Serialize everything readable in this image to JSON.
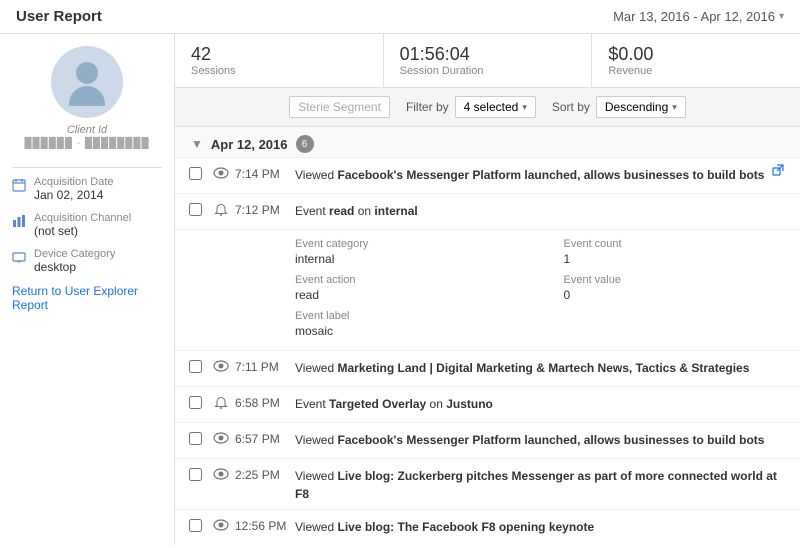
{
  "header": {
    "title": "User Report",
    "date_range": "Mar 13, 2016 - Apr 12, 2016"
  },
  "stats": [
    {
      "value": "42",
      "label": "Sessions"
    },
    {
      "value": "01:56:04",
      "label": "Session Duration"
    },
    {
      "value": "$0.00",
      "label": "Revenue"
    }
  ],
  "filter_bar": {
    "filter_by_label": "Filter by",
    "sort_by_label": "Sort by",
    "segment_placeholder": "Sterie Segment",
    "selected_count": "4 selected",
    "sort_value": "Descending"
  },
  "sidebar": {
    "client_id_label": "Client Id",
    "client_id_value": "██████ - ████████",
    "items": [
      {
        "icon": "calendar",
        "label": "Acquisition Date",
        "value": "Jan 02, 2014"
      },
      {
        "icon": "bar-chart",
        "label": "Acquisition Channel",
        "value": "(not set)"
      },
      {
        "icon": "device",
        "label": "Device Category",
        "value": "desktop"
      }
    ],
    "return_link": "Return to User Explorer Report"
  },
  "date_groups": [
    {
      "date": "Apr 12, 2016",
      "count": 6,
      "events": [
        {
          "time": "7:14 PM",
          "type": "view",
          "description": "Viewed <b>Facebook's Messenger Platform launched, allows businesses to build bots</b>",
          "has_link": true,
          "expanded": false
        },
        {
          "time": "7:12 PM",
          "type": "event",
          "description": "Event <b>read</b> on <b>internal</b>",
          "has_link": false,
          "expanded": true,
          "details": {
            "event_category_label": "Event category",
            "event_category_value": "internal",
            "event_count_label": "Event count",
            "event_count_value": "1",
            "event_action_label": "Event action",
            "event_action_value": "read",
            "event_value_label": "Event value",
            "event_value_value": "0",
            "event_label_label": "Event label",
            "event_label_value": "mosaic"
          }
        },
        {
          "time": "7:11 PM",
          "type": "view",
          "description": "Viewed <b>Marketing Land | Digital Marketing & Martech News, Tactics & Strategies</b>",
          "has_link": false,
          "expanded": false
        },
        {
          "time": "6:58 PM",
          "type": "event",
          "description": "Event <b>Targeted Overlay</b> on <b>Justuno</b>",
          "has_link": false,
          "expanded": false
        },
        {
          "time": "6:57 PM",
          "type": "view",
          "description": "Viewed <b>Facebook's Messenger Platform launched, allows businesses to build bots</b>",
          "has_link": false,
          "expanded": false
        },
        {
          "time": "2:25 PM",
          "type": "view",
          "description": "Viewed <b>Live blog: Zuckerberg pitches Messenger as part of more connected world at F8</b>",
          "has_link": false,
          "expanded": false
        },
        {
          "time": "12:56 PM",
          "type": "view",
          "description": "Viewed <b>Live blog: The Facebook F8 opening keynote</b>",
          "has_link": false,
          "expanded": false
        }
      ]
    }
  ]
}
